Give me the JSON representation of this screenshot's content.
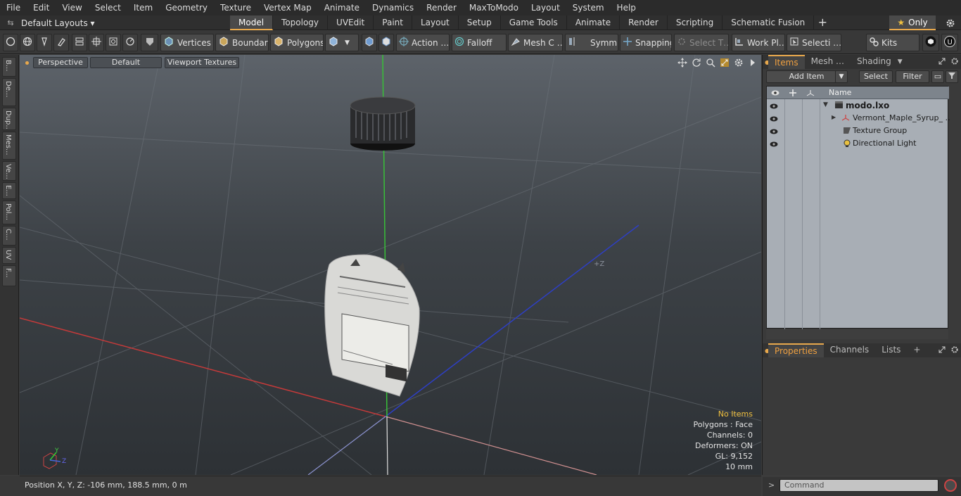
{
  "menu": [
    "File",
    "Edit",
    "View",
    "Select",
    "Item",
    "Geometry",
    "Texture",
    "Vertex Map",
    "Animate",
    "Dynamics",
    "Render",
    "MaxToModo",
    "Layout",
    "System",
    "Help"
  ],
  "layout_selector": {
    "label": "Default Layouts ▾"
  },
  "tabs": [
    {
      "label": "Model",
      "active": true
    },
    {
      "label": "Topology"
    },
    {
      "label": "UVEdit"
    },
    {
      "label": "Paint"
    },
    {
      "label": "Layout"
    },
    {
      "label": "Setup"
    },
    {
      "label": "Game Tools"
    },
    {
      "label": "Animate"
    },
    {
      "label": "Render"
    },
    {
      "label": "Scripting"
    },
    {
      "label": "Schematic Fusion"
    }
  ],
  "tab_plus": "+",
  "only_label": "Only",
  "toolbar": {
    "vertices": "Vertices",
    "boundary": "Boundary",
    "polygons": "Polygons",
    "action": "Action …",
    "falloff": "Falloff",
    "mesh_c": "Mesh C …",
    "symm": "Symm …",
    "snapping": "Snapping",
    "select_t": "Select T…",
    "work_pl": "Work Pl…",
    "selecti": "Selecti …",
    "kits": "Kits"
  },
  "left_tabs": [
    "B...",
    "De...",
    "Dup...",
    "Mes...",
    "Ve...",
    "E...",
    "Pol...",
    "C...",
    "UV",
    "F..."
  ],
  "viewport": {
    "perspective": "Perspective",
    "default": "Default",
    "viewport_textures": "Viewport Textures",
    "axis_label": "+Z",
    "gizmo_y": "Y",
    "gizmo_z": "Z",
    "stats": {
      "no_items": "No Items",
      "polygons": "Polygons : Face",
      "channels": "Channels: 0",
      "deformers": "Deformers: ON",
      "gl": "GL: 9,152",
      "scale": "10 mm"
    }
  },
  "statusbar": {
    "position": "Position X, Y, Z:  -106 mm, 188.5 mm, 0 m"
  },
  "items_panel": {
    "tabs": [
      {
        "label": "Items",
        "active": true
      },
      {
        "label": "Mesh …"
      },
      {
        "label": "Shading"
      }
    ],
    "add_item": "Add Item",
    "select": "Select",
    "filter": "Filter",
    "col_name": "Name",
    "rows": [
      {
        "label": "modo.lxo",
        "bold": true
      },
      {
        "label": "Vermont_Maple_Syrup_ …"
      },
      {
        "label": "Texture Group"
      },
      {
        "label": "Directional Light"
      }
    ]
  },
  "props_panel": {
    "tabs": [
      {
        "label": "Properties",
        "active": true
      },
      {
        "label": "Channels"
      },
      {
        "label": "Lists"
      }
    ],
    "plus": "+"
  },
  "command": {
    "placeholder": "Command"
  }
}
